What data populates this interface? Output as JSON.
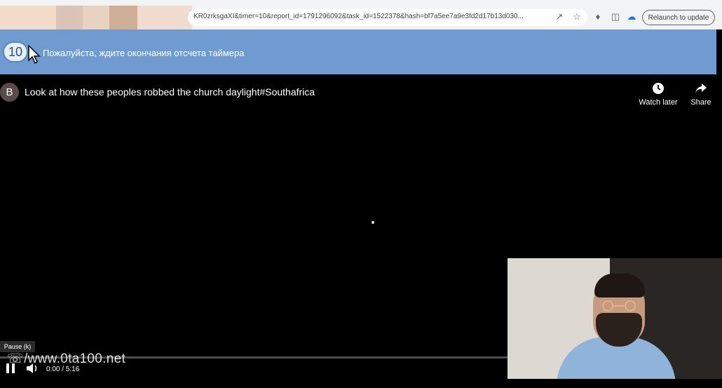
{
  "browser": {
    "url": "KR0zrksgaXI&timer=10&report_id=1791296092&task_id=1522378&hash=bf7a5ee7a9e3fd2d17b13d030...",
    "relaunch_label": "Relaunch to update"
  },
  "banner": {
    "timer_value": "10",
    "message": "Пожалуйста, ждите окончания отсчета таймера"
  },
  "video": {
    "channel_initial": "B",
    "title": "Look at how these peoples robbed the church daylight#Southafrica",
    "watch_later_label": "Watch later",
    "share_label": "Share",
    "pause_tooltip": "Pause (k)",
    "time_display": "0:00 / 5:16",
    "progress": 0.0,
    "watermark": "/www.0ta100.net"
  }
}
